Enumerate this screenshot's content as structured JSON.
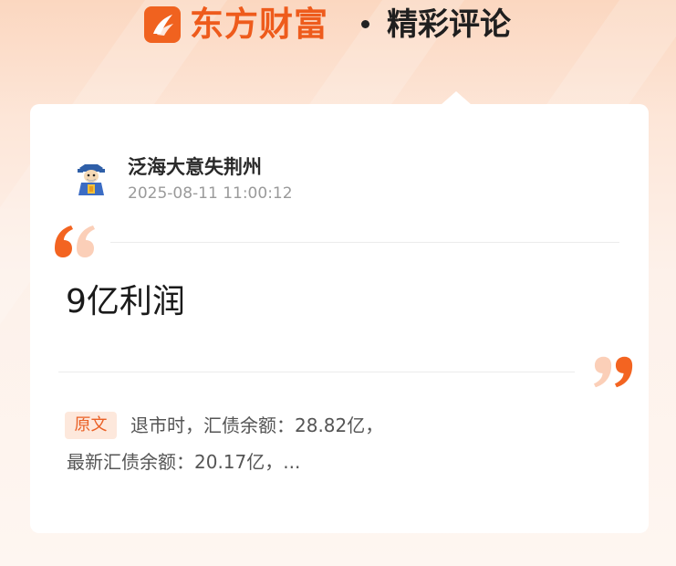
{
  "header": {
    "brand": "东方财富",
    "section": "精彩评论"
  },
  "post": {
    "username": "泛海大意失荆州",
    "timestamp": "2025-08-11 11:00:12",
    "comment": "9亿利润"
  },
  "original": {
    "badge": "原文",
    "line1": "退市时，汇债余额：28.82亿，",
    "line2": "最新汇债余额：20.17亿，..."
  },
  "colors": {
    "brand_orange": "#ee5b1c",
    "quote_orange": "#f36421",
    "quote_light": "#fbcfb8"
  }
}
